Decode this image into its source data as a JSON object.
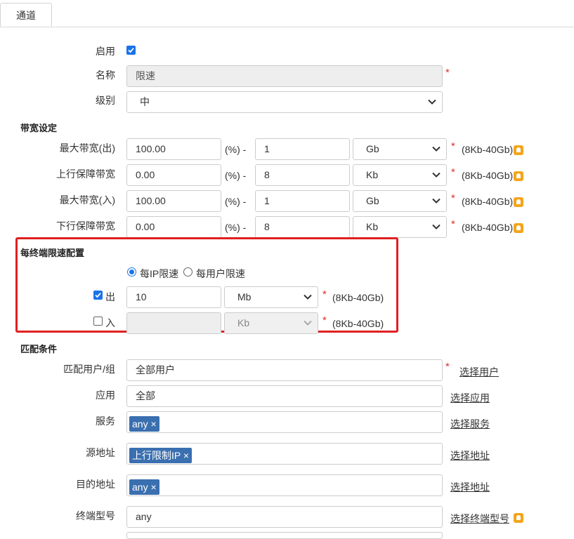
{
  "tab": {
    "label": "通道"
  },
  "basic": {
    "enable_label": "启用",
    "name_label": "名称",
    "name_value": "限速",
    "level_label": "级别",
    "level_value": "中"
  },
  "bandwidth": {
    "section": "带宽设定",
    "pct_sep": "(%) -",
    "rows": [
      {
        "label": "最大带宽(出)",
        "pct": "100.00",
        "value": "1",
        "unit": "Gb",
        "hint": "(8Kb-40Gb)"
      },
      {
        "label": "上行保障带宽",
        "pct": "0.00",
        "value": "8",
        "unit": "Kb",
        "hint": "(8Kb-40Gb)"
      },
      {
        "label": "最大带宽(入)",
        "pct": "100.00",
        "value": "1",
        "unit": "Gb",
        "hint": "(8Kb-40Gb)"
      },
      {
        "label": "下行保障带宽",
        "pct": "0.00",
        "value": "8",
        "unit": "Kb",
        "hint": "(8Kb-40Gb)"
      }
    ]
  },
  "per_terminal": {
    "section": "每终端限速配置",
    "radio_ip": "每IP限速",
    "radio_user": "每用户限速",
    "out_label": "出",
    "out_value": "10",
    "out_unit": "Mb",
    "in_label": "入",
    "in_value": "",
    "in_unit": "Kb",
    "hint": "(8Kb-40Gb)"
  },
  "match": {
    "section": "匹配条件",
    "user_label": "匹配用户/组",
    "user_value": "全部用户",
    "user_link": "选择用户",
    "app_label": "应用",
    "app_value": "全部",
    "app_link": "选择应用",
    "service_label": "服务",
    "service_tag": "any ×",
    "service_link": "选择服务",
    "src_label": "源地址",
    "src_tag": "上行限制IP ×",
    "src_link": "选择地址",
    "dst_label": "目的地址",
    "dst_tag": "any ×",
    "dst_link": "选择地址",
    "terminal_label": "终端型号",
    "terminal_value": "any",
    "terminal_link": "选择终端型号"
  },
  "required_mark": "*",
  "colors": {
    "accent": "#1a73e8",
    "required": "#e03030",
    "tag_bg": "#3a6fb0",
    "highlight_box": "#e02020",
    "hint_icon": "#f3a51c"
  }
}
